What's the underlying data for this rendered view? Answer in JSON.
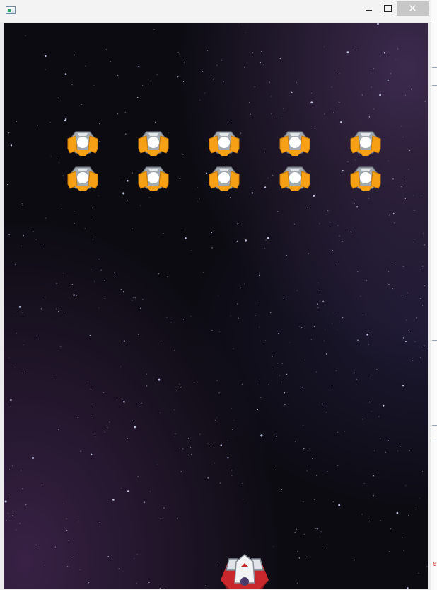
{
  "window": {
    "title": "",
    "controls": {
      "minimize_icon": "minimize-icon",
      "maximize_icon": "maximize-icon",
      "close_label": "✕"
    }
  },
  "game": {
    "background": "starfield",
    "enemy_rows": [
      {
        "row": 1,
        "count": 5
      },
      {
        "row": 2,
        "count": 5
      }
    ],
    "enemy_icon": "enemy-ship-icon",
    "player_icon": "player-ship-icon"
  },
  "background_window": {
    "text_fragment": "e"
  },
  "colors": {
    "space": "#0c0b12",
    "nebula": "#6a3f8a",
    "enemy_orange": "#f5a015",
    "enemy_gray": "#9aa0a8",
    "player_red": "#c8282b"
  }
}
